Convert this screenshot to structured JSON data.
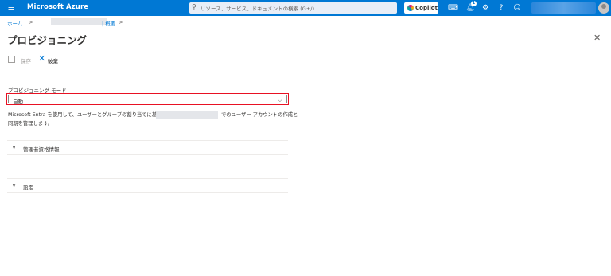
{
  "topbar": {
    "menu_icon": "hamburger-icon",
    "brand": "Microsoft Azure",
    "search_placeholder": "リソース、サービス、ドキュメントの検索 (G+/)",
    "copilot_label": "Copilot",
    "notification_count": "1",
    "icons": [
      "terminal-icon",
      "bell-icon",
      "gear-icon",
      "help-icon",
      "feedback-icon"
    ]
  },
  "breadcrumb": {
    "home": "ホーム",
    "separator": ">",
    "overview": "| 概要"
  },
  "page": {
    "title": "プロビジョニング",
    "more": "···",
    "close": "✕"
  },
  "commands": {
    "save": "保存",
    "discard": "破棄"
  },
  "provisioning": {
    "mode_label": "プロビジョニング モード",
    "mode_value": "自動",
    "description_part1": "Microsoft Entra を使用して、ユーザーとグループの割り当てに基づいた",
    "description_part2": "でのユーザー アカウントの作成と",
    "description_line2": "同期を管理します。"
  },
  "sections": [
    {
      "label": "管理者資格情報"
    },
    {
      "label": "設定"
    }
  ],
  "colors": {
    "topbar": "#0078d4",
    "highlight_border": "#e81123",
    "link": "#0078d4"
  }
}
